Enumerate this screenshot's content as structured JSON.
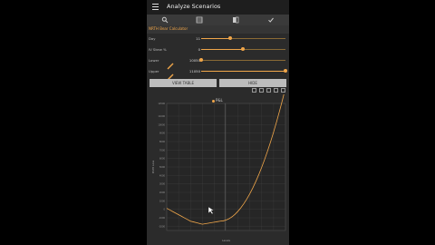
{
  "app": {
    "title": "Analyze Scenarios"
  },
  "toolbar": {
    "icons": [
      "search-icon",
      "table-icon",
      "compare-icon",
      "check-icon"
    ]
  },
  "calc": {
    "label": "NRTH Bear Calculator"
  },
  "params": [
    {
      "name": "Day",
      "value": "11",
      "slider": 0.35
    },
    {
      "name": "IV Skew %",
      "value": "0",
      "slider": 0.5
    },
    {
      "name": "Lower",
      "value": "10050",
      "slider": 0.0
    },
    {
      "name": "Upper",
      "value": "11050",
      "slider": 1.0
    }
  ],
  "buttons": {
    "view_table": "VIEW TABLE",
    "hide": "HIDE"
  },
  "chart_data": {
    "type": "line",
    "legend": [
      "P&L"
    ],
    "line_color": "#f0a64a",
    "xlabel": "Levels",
    "ylabel": "Profit Loss",
    "ylim": [
      -2500,
      12500
    ],
    "yticks": [
      12500,
      11000,
      10000,
      9000,
      8000,
      7000,
      6000,
      5000,
      4000,
      3000,
      2000,
      1000,
      0,
      -1000,
      -2000
    ],
    "xlim": [
      10050,
      11050
    ],
    "grid": true
  },
  "colors": {
    "accent": "#f0a64a",
    "background": "#2b2b2b",
    "appbar": "#1e1e1e"
  }
}
